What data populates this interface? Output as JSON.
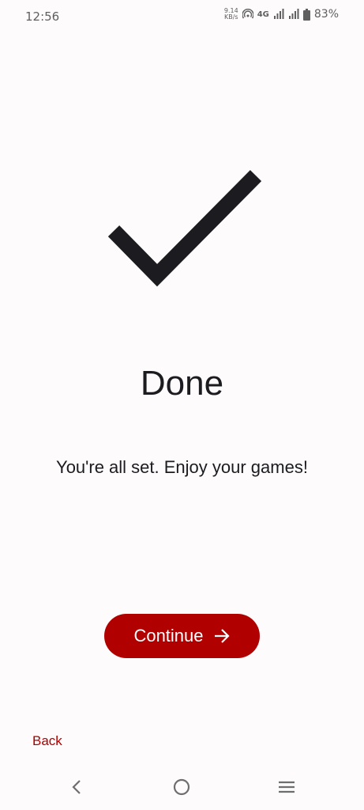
{
  "status_bar": {
    "time": "12:56",
    "net_speed_value": "9.14",
    "net_speed_unit": "KB/s",
    "network_type": "4G",
    "battery_percent": "83%",
    "icons": [
      "hotspot-icon",
      "signal-4g-icon",
      "signal-icon",
      "battery-icon"
    ]
  },
  "main": {
    "icon": "checkmark-icon",
    "title": "Done",
    "message": "You're all set. Enjoy your games!",
    "continue_label": "Continue",
    "continue_icon": "arrow-right-icon",
    "back_label": "Back"
  },
  "nav_bar": {
    "icons": [
      "back-nav-icon",
      "home-nav-icon",
      "recents-nav-icon"
    ]
  },
  "colors": {
    "accent": "#b00000",
    "background": "#fdfbfc",
    "text": "#1c1b1f"
  }
}
